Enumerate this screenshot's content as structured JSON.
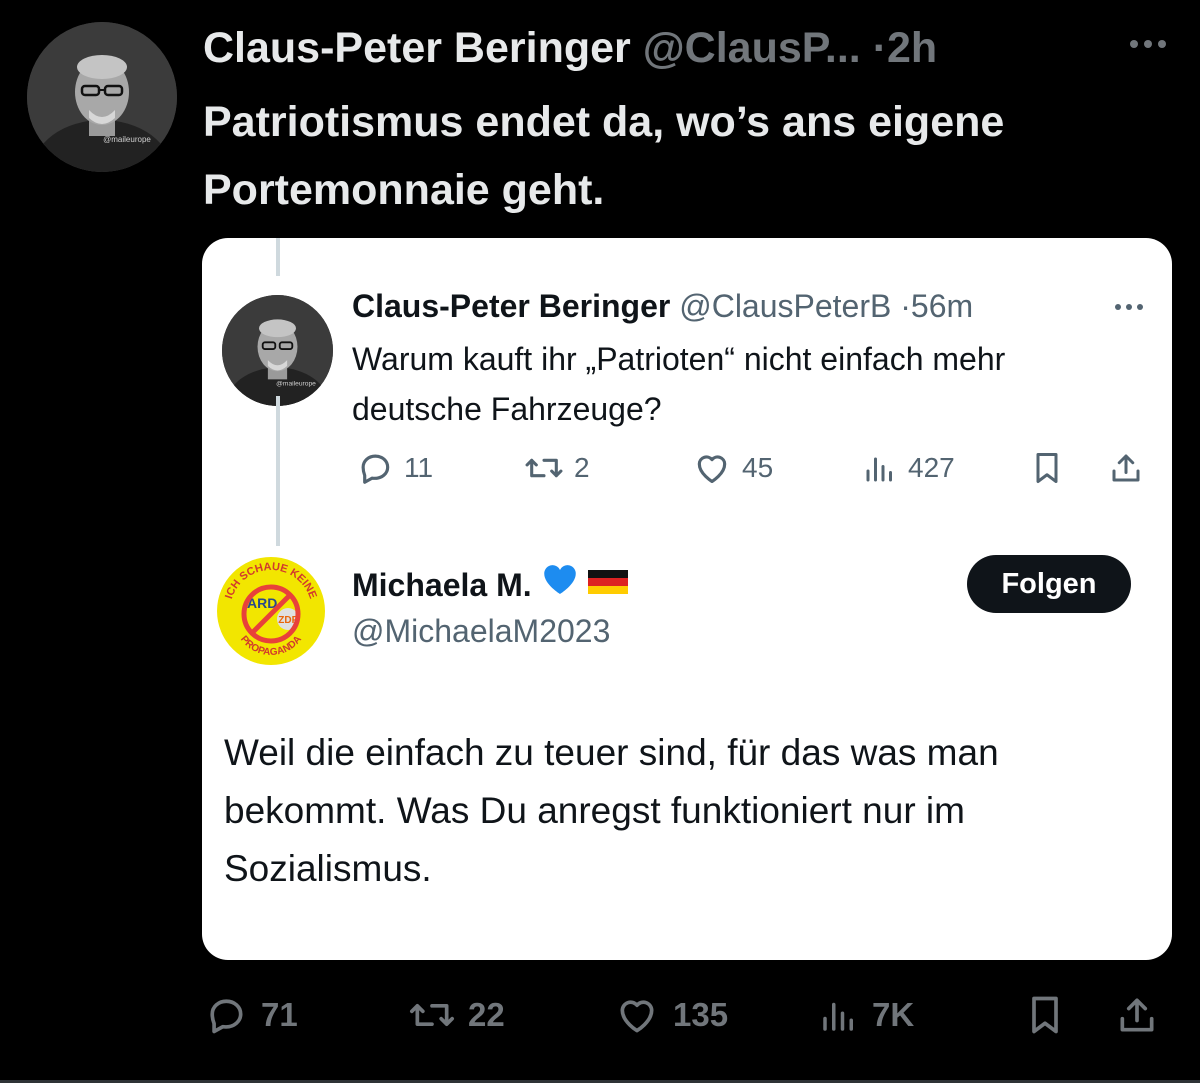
{
  "outer_tweet": {
    "author_name": "Claus-Peter Beringer",
    "handle": "@ClausP...",
    "separator": "·",
    "time": "2h",
    "avatar_caption": "@maileurope",
    "text": "Patriotismus endet da, wo’s ans eigene Portemonnaie geht.",
    "actions": {
      "replies": "71",
      "reposts": "22",
      "likes": "135",
      "views": "7K"
    }
  },
  "quoted_tweet": {
    "author_name": "Claus-Peter Beringer",
    "handle": "@ClausPeterB",
    "separator": "·",
    "time": "56m",
    "avatar_caption": "@maileurope",
    "text": "Warum kauft ihr „Patrioten“ nicht einfach mehr deutsche Fahrzeuge?",
    "actions": {
      "replies": "11",
      "reposts": "2",
      "likes": "45",
      "views": "427"
    }
  },
  "reply_tweet": {
    "author_name": "Michaela M.",
    "name_emojis": "💙",
    "handle": "@MichaelaM2023",
    "follow_label": "Folgen",
    "avatar_text": {
      "top_arc": "ICH SCHAUE KEINE",
      "bottom_arc": "PROPAGANDA",
      "left_logo": "ARD",
      "right_logo": "ZDF"
    },
    "text": "Weil die einfach zu teuer sind, für das was man bekommt. Was Du anregst funktioniert nur im Sozialismus."
  },
  "colors": {
    "background": "#000000",
    "card": "#ffffff",
    "muted_dark": "#71767b",
    "muted_light": "#536471",
    "text_dark": "#0f1419",
    "avatar_yellow": "#f2e600",
    "prohibition_red": "#e8413a"
  },
  "icons": [
    "more-icon",
    "reply-icon",
    "repost-icon",
    "like-icon",
    "views-icon",
    "bookmark-icon",
    "share-icon",
    "blue-heart-emoji",
    "german-flag-emoji"
  ]
}
